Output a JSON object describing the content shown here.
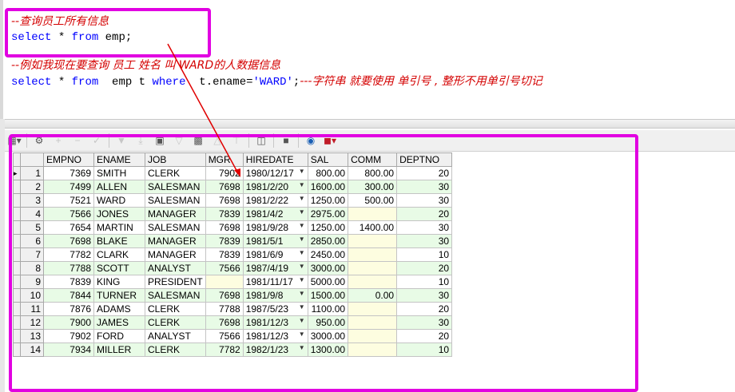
{
  "editor": {
    "line1": "--查询员工所有信息",
    "line2_kw1": "select",
    "line2_rest": " * ",
    "line2_kw2": "from",
    "line2_tail": " emp;",
    "line3": "--例如我现在要查询 员工 姓名 叫 WARD的人数据信息",
    "line4_kw1": "select",
    "line4_a": " * ",
    "line4_kw2": "from",
    "line4_b": "  emp t ",
    "line4_kw3": "where",
    "line4_c": "  t.ename=",
    "line4_str": "'WARD'",
    "line4_d": ";",
    "line4_cmt": "---字符串 就要使用 单引号 , 整形不用单引号切记"
  },
  "toolbar": {
    "icons": [
      "grid-menu-icon",
      "separator",
      "lock-icon",
      "add-record-icon",
      "delete-record-icon",
      "post-record-icon",
      "separator",
      "query-icon",
      "clear-icon",
      "separator",
      "find-icon",
      "next-icon",
      "prev-icon",
      "separator",
      "single-record-icon",
      "separator",
      "export-icon",
      "separator",
      "chart-icon",
      "options-icon"
    ]
  },
  "grid": {
    "columns": [
      "EMPNO",
      "ENAME",
      "JOB",
      "MGR",
      "HIREDATE",
      "SAL",
      "COMM",
      "DEPTNO"
    ],
    "rows": [
      {
        "n": "1",
        "empno": "7369",
        "ename": "SMITH",
        "job": "CLERK",
        "mgr": "7902",
        "hiredate": "1980/12/17",
        "sal": "800.00",
        "comm": "800.00",
        "deptno": "20"
      },
      {
        "n": "2",
        "empno": "7499",
        "ename": "ALLEN",
        "job": "SALESMAN",
        "mgr": "7698",
        "hiredate": "1981/2/20",
        "sal": "1600.00",
        "comm": "300.00",
        "deptno": "30"
      },
      {
        "n": "3",
        "empno": "7521",
        "ename": "WARD",
        "job": "SALESMAN",
        "mgr": "7698",
        "hiredate": "1981/2/22",
        "sal": "1250.00",
        "comm": "500.00",
        "deptno": "30"
      },
      {
        "n": "4",
        "empno": "7566",
        "ename": "JONES",
        "job": "MANAGER",
        "mgr": "7839",
        "hiredate": "1981/4/2",
        "sal": "2975.00",
        "comm": "",
        "deptno": "20"
      },
      {
        "n": "5",
        "empno": "7654",
        "ename": "MARTIN",
        "job": "SALESMAN",
        "mgr": "7698",
        "hiredate": "1981/9/28",
        "sal": "1250.00",
        "comm": "1400.00",
        "deptno": "30"
      },
      {
        "n": "6",
        "empno": "7698",
        "ename": "BLAKE",
        "job": "MANAGER",
        "mgr": "7839",
        "hiredate": "1981/5/1",
        "sal": "2850.00",
        "comm": "",
        "deptno": "30"
      },
      {
        "n": "7",
        "empno": "7782",
        "ename": "CLARK",
        "job": "MANAGER",
        "mgr": "7839",
        "hiredate": "1981/6/9",
        "sal": "2450.00",
        "comm": "",
        "deptno": "10"
      },
      {
        "n": "8",
        "empno": "7788",
        "ename": "SCOTT",
        "job": "ANALYST",
        "mgr": "7566",
        "hiredate": "1987/4/19",
        "sal": "3000.00",
        "comm": "",
        "deptno": "20"
      },
      {
        "n": "9",
        "empno": "7839",
        "ename": "KING",
        "job": "PRESIDENT",
        "mgr": "",
        "hiredate": "1981/11/17",
        "sal": "5000.00",
        "comm": "",
        "deptno": "10"
      },
      {
        "n": "10",
        "empno": "7844",
        "ename": "TURNER",
        "job": "SALESMAN",
        "mgr": "7698",
        "hiredate": "1981/9/8",
        "sal": "1500.00",
        "comm": "0.00",
        "deptno": "30"
      },
      {
        "n": "11",
        "empno": "7876",
        "ename": "ADAMS",
        "job": "CLERK",
        "mgr": "7788",
        "hiredate": "1987/5/23",
        "sal": "1100.00",
        "comm": "",
        "deptno": "20"
      },
      {
        "n": "12",
        "empno": "7900",
        "ename": "JAMES",
        "job": "CLERK",
        "mgr": "7698",
        "hiredate": "1981/12/3",
        "sal": "950.00",
        "comm": "",
        "deptno": "30"
      },
      {
        "n": "13",
        "empno": "7902",
        "ename": "FORD",
        "job": "ANALYST",
        "mgr": "7566",
        "hiredate": "1981/12/3",
        "sal": "3000.00",
        "comm": "",
        "deptno": "20"
      },
      {
        "n": "14",
        "empno": "7934",
        "ename": "MILLER",
        "job": "CLERK",
        "mgr": "7782",
        "hiredate": "1982/1/23",
        "sal": "1300.00",
        "comm": "",
        "deptno": "10"
      }
    ]
  },
  "colors": {
    "highlight": "#e100e1",
    "arrow": "#e00000",
    "comment": "#d40000",
    "keyword": "#0000ff",
    "row_alt": "#e8fbe6",
    "null_cell": "#fdfde0"
  }
}
